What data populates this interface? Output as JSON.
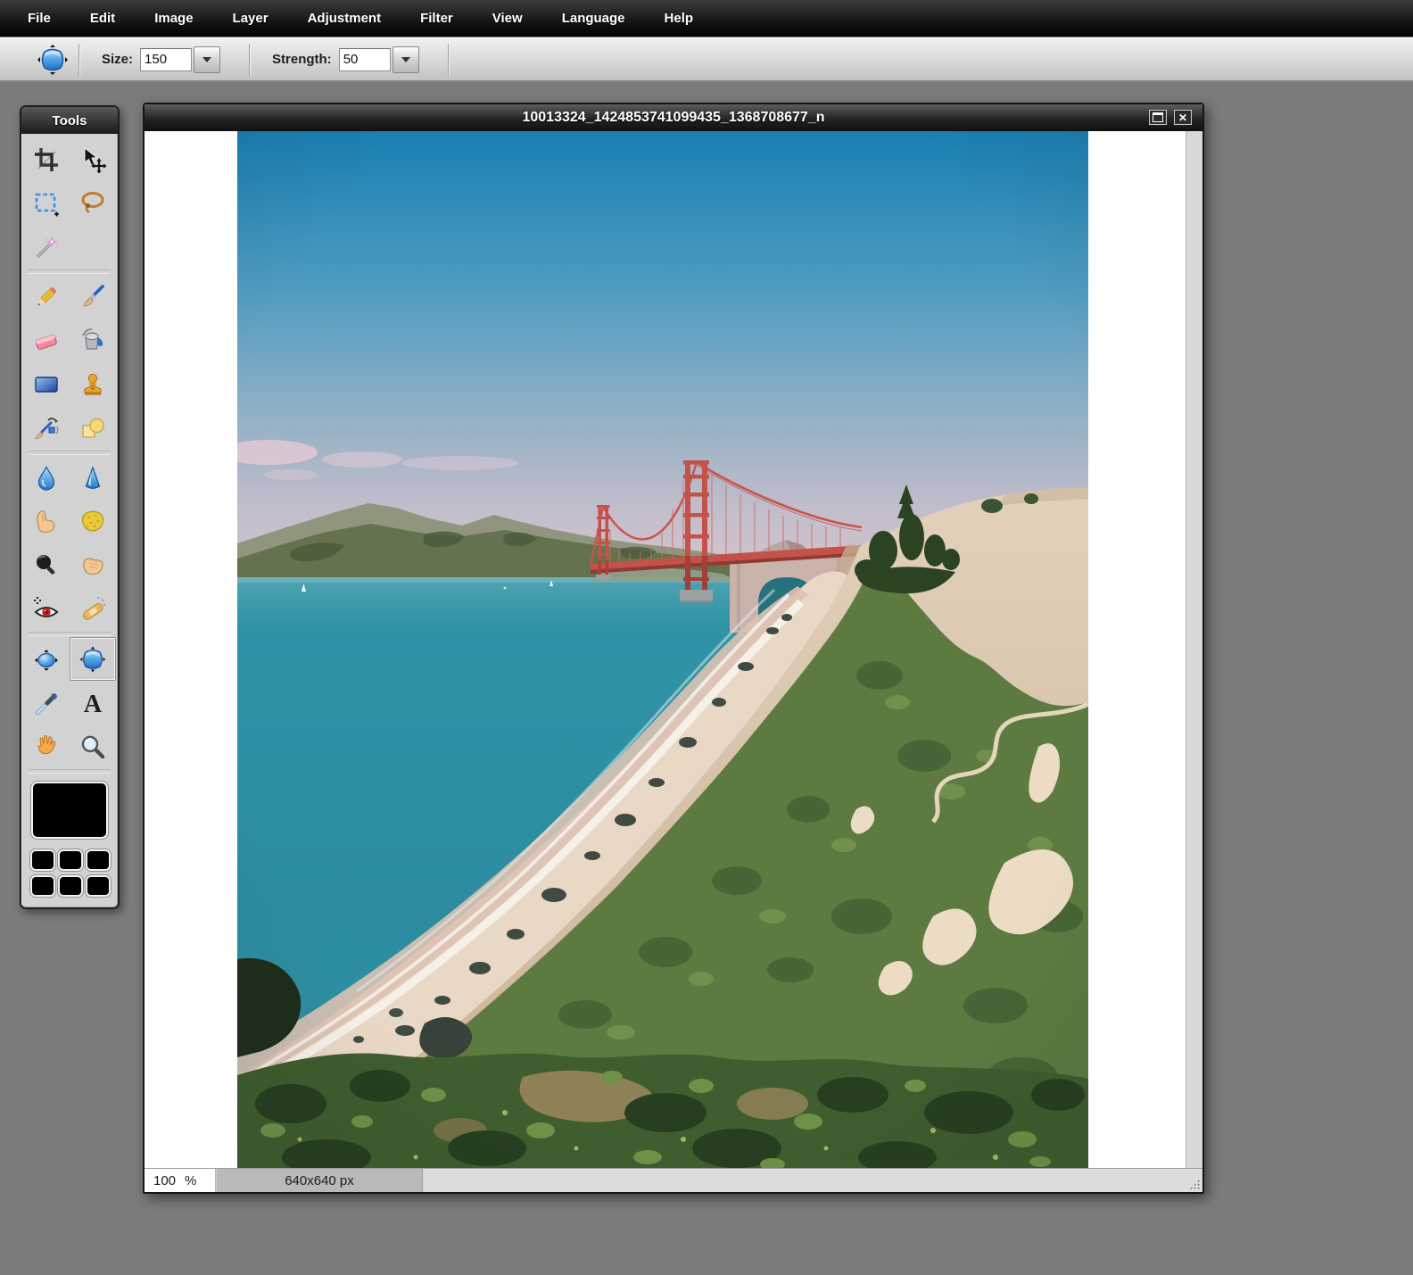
{
  "menu": {
    "items": [
      "File",
      "Edit",
      "Image",
      "Layer",
      "Adjustment",
      "Filter",
      "View",
      "Language",
      "Help"
    ]
  },
  "options_bar": {
    "active_tool": "pinch",
    "size_label": "Size:",
    "size_value": "150",
    "strength_label": "Strength:",
    "strength_value": "50"
  },
  "toolbox": {
    "title": "Tools",
    "selected_tool": "pinch",
    "foreground_color": "#000000",
    "tools": [
      "crop",
      "move",
      "marquee-select",
      "lasso-select",
      "wand-select",
      "pencil",
      "brush",
      "eraser",
      "fill",
      "gradient",
      "clone-stamp",
      "color-replace",
      "drawing",
      "blur",
      "sharpen",
      "smudge",
      "sponge",
      "dodge",
      "burn",
      "red-eye-reduction",
      "spot-heal",
      "bloat",
      "pinch",
      "color-picker",
      "type",
      "hand",
      "zoom"
    ]
  },
  "window": {
    "title": "10013324_1424853741099435_1368708677_n",
    "buttons": [
      "maximize",
      "close"
    ],
    "close_glyph": "✕"
  },
  "status_bar": {
    "zoom_value": "100",
    "zoom_unit": "%",
    "dimensions": "640x640 px"
  },
  "photo_palette": {
    "sky_top": "#1a7fb3",
    "sky_horizon": "#d6c6ce",
    "water": "#2e93a4",
    "bridge_red": "#c9544a",
    "mountain": "#65724f",
    "sand": "#dbc8b0",
    "vegetation": "#4f6d3a"
  }
}
